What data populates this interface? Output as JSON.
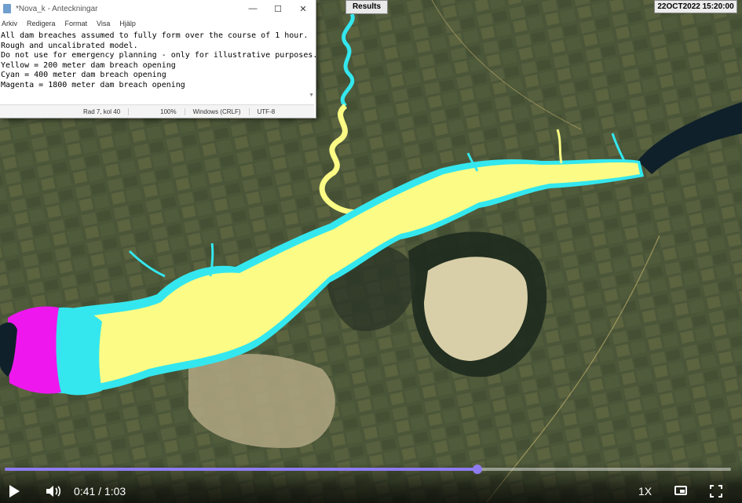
{
  "notepad": {
    "title": "*Nova_k - Anteckningar",
    "window_buttons": {
      "minimize": "—",
      "maximize": "☐",
      "close": "✕"
    },
    "menu": [
      "Arkiv",
      "Redigera",
      "Format",
      "Visa",
      "Hjälp"
    ],
    "text_lines": [
      "All dam breaches assumed to fully form over the course of 1 hour.",
      "Rough and uncalibrated model.",
      "Do not use for emergency planning - only for illustrative purposes.",
      "",
      "Yellow = 200 meter dam breach opening",
      "Cyan = 400 meter dam breach opening",
      "Magenta = 1800 meter dam breach opening"
    ],
    "status": {
      "position": "Rad 7, kol 40",
      "zoom": "100%",
      "line_endings": "Windows (CRLF)",
      "encoding": "UTF-8"
    }
  },
  "map": {
    "results_label": "Results",
    "timestamp": "22OCT2022 15:20:00",
    "colors": {
      "land": "#4a5538",
      "water": "#10202a",
      "yellow": "#fbfb85",
      "cyan": "#34e7ee",
      "magenta": "#ee18ee",
      "sand": "#b8ae8c"
    }
  },
  "player": {
    "current_time": "0:41",
    "duration": "1:03",
    "time_display": "0:41 / 1:03",
    "progress": 0.6508,
    "speed": "1X",
    "accent": "#8e7cf0",
    "icons": [
      "play-icon",
      "volume-icon",
      "pip-icon",
      "fullscreen-icon"
    ]
  }
}
